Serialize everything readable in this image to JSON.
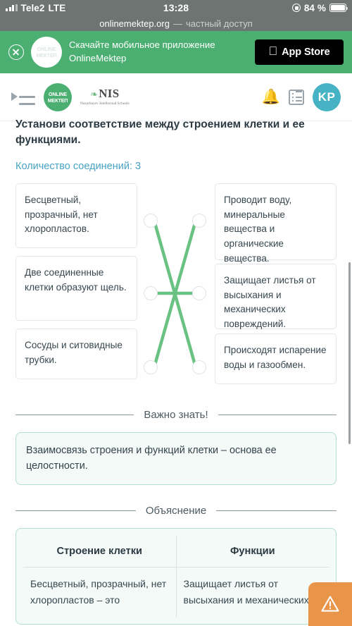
{
  "status_bar": {
    "carrier": "Tele2",
    "network": "LTE",
    "time": "13:28",
    "battery_percent": "84 %",
    "lock_icon": "lock-rotation-icon",
    "signal_icon": "signal-bars-icon",
    "battery_icon": "battery-icon"
  },
  "url_bar": {
    "host": "onlinemektep.org",
    "separator": "—",
    "mode": "частный доступ"
  },
  "app_banner": {
    "close_icon": "close-circle-icon",
    "logo_line1": "ONLINE",
    "logo_line2": "МЕКТЕП",
    "text_line1": "Скачайте мобильное приложение",
    "text_line2": "OnlineMektep",
    "store_button": "App Store",
    "apple_icon": "apple-icon",
    "background": "#4caf72"
  },
  "site_header": {
    "menu_icon": "hamburger-menu-icon",
    "om_logo_line1": "ONLINE",
    "om_logo_line2": "МЕКТЕП",
    "nis_name": "NIS",
    "nis_sub": "Nazarbayev Intellectual Schools",
    "nis_leaf_icon": "leaf-icon",
    "bell_icon": "bell-icon",
    "list_icon": "list-icon",
    "avatar_initials": "KP",
    "avatar_color": "#45b3c4"
  },
  "question": {
    "title": "Установи соответствие между строением клетки и ее функциями.",
    "connections_label": "Количество соединений: 3",
    "accent_color": "#4aa3c4"
  },
  "matching": {
    "left_items": [
      "Бесцветный, прозрачный, нет хлоропластов.",
      "Две соединенные клетки образуют щель.",
      "Сосуды и ситовидные трубки."
    ],
    "right_items": [
      "Проводит воду, минеральные вещества и органические вещества.",
      "Защищает листья от высыхания и механических повреждений.",
      "Происходят испарение воды и газообмен."
    ],
    "line_color": "#6ac282",
    "links": [
      {
        "from": 0,
        "to": 2
      },
      {
        "from": 1,
        "to": 1
      },
      {
        "from": 2,
        "to": 0
      }
    ]
  },
  "important": {
    "heading": "Важно знать!",
    "text": "Взаимосвязь строения и функций клетки – основа ее целостности."
  },
  "explanation": {
    "heading": "Объяснение",
    "table": {
      "headers": [
        "Строение клетки",
        "Функции"
      ],
      "rows": [
        [
          "Бесцветный, прозрачный, нет хлоропластов – это",
          "Защищает листья от высыхания и механических"
        ]
      ]
    }
  },
  "fab": {
    "icon": "warning-triangle-icon",
    "color": "#e8954a"
  }
}
